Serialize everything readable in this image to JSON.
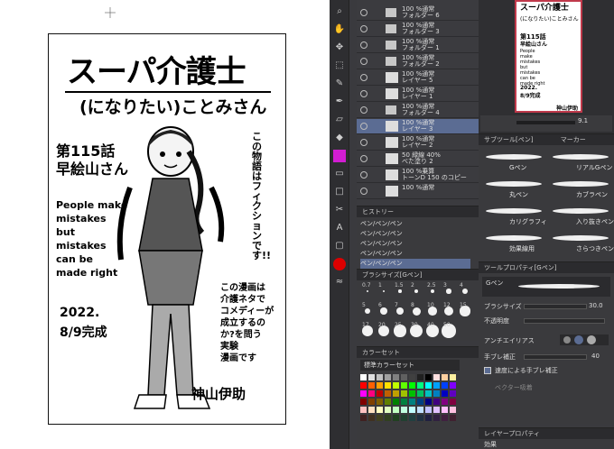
{
  "page": {
    "title_main": "スーパ介護士",
    "title_sub": "(になりたい)ことみさん",
    "episode_lines": [
      "第115話",
      "早絵山さん"
    ],
    "english_lines": [
      "People make",
      "mistakes",
      "but",
      "mistakes",
      "can be",
      "made right"
    ],
    "vertical_note": "この物語はフィクションです!!",
    "note_lines": [
      "この漫画は",
      "介護ネタで",
      "コメディーが",
      "成立するの",
      "か?を問う",
      "実験",
      "漫画です"
    ],
    "date_lines": [
      "2022.",
      "8/9完成"
    ],
    "author": "神山伊助"
  },
  "layers": {
    "rows": [
      {
        "label": "100 %通常\nフォルダー 6",
        "type": "folder"
      },
      {
        "label": "100 %通常\nフォルダー 3",
        "type": "folder"
      },
      {
        "label": "100 %通常\nフォルダー 1",
        "type": "folder"
      },
      {
        "label": "100 %通常\nフォルダー 2",
        "type": "folder"
      },
      {
        "label": "100 %通常\nレイヤー 5",
        "type": "layer"
      },
      {
        "label": "100 %通常\nレイヤー 1",
        "type": "layer"
      },
      {
        "label": "100 %通常\nフォルダー 4",
        "type": "folder"
      },
      {
        "label": "100 %通常\nレイヤー 3",
        "type": "layer",
        "selected": true
      },
      {
        "label": "100 %通常\nレイヤー 2",
        "type": "layer"
      },
      {
        "label": "50 緑線 40%\nべた塗り 2",
        "type": "layer"
      },
      {
        "label": "100 %乗算\nトーンD 150 のコピー",
        "type": "layer"
      },
      {
        "label": "100 %通常",
        "type": "layer"
      }
    ]
  },
  "navigator": {
    "title_lines": [
      "スーパ介護士",
      "(になりたい)ことみさん"
    ],
    "episode": "第115話",
    "episode2": "早絵山さん",
    "english": "People make mistakes but mistakes can be made right",
    "date": "2022. 8/9完成",
    "author": "神山伊助",
    "zoom": "9.1"
  },
  "history": {
    "title": "ヒストリー",
    "rows": [
      "ペン/ペン/ペン",
      "ペン/ペン/ペン",
      "ペン/ペン/ペン",
      "ペン/ペン/ペン",
      "ペン/ペン/ペン"
    ]
  },
  "subtools": {
    "tab1": "サブツール[ペン]",
    "tab2": "マーカー",
    "items": [
      {
        "name": "Gペン"
      },
      {
        "name": "リアルGペン"
      },
      {
        "name": "丸ペン"
      },
      {
        "name": "カブラペン"
      },
      {
        "name": "カリグラフィ"
      },
      {
        "name": "入り抜きペン"
      },
      {
        "name": "効果線用"
      },
      {
        "name": "さらつきペン"
      }
    ]
  },
  "brushsize": {
    "title": "ブラシサイズ[Gペン]",
    "labels": [
      "0.7",
      "1",
      "1.5",
      "2",
      "2.5",
      "3",
      "4",
      "5",
      "6",
      "7",
      "8",
      "10",
      "12",
      "15",
      "17",
      "20",
      "25",
      "30",
      "40",
      "50"
    ]
  },
  "colorset": {
    "title": "カラーセット",
    "name": "標準カラーセット"
  },
  "toolprop": {
    "title": "ツールプロパティ[Gペン]",
    "tool_name": "Gペン",
    "brush_size_label": "ブラシサイズ",
    "brush_size_value": "30.0",
    "opacity_label": "不透明度",
    "antialias_label": "アンチエイリアス",
    "stabilize_label": "手ブレ補正",
    "stabilize_value": "40",
    "speed_label": "速度による手ブレ補正",
    "vector_label": "ベクター吸着"
  },
  "layerprop": {
    "title": "レイヤープロパティ",
    "effect_label": "効果"
  },
  "colors": {
    "ui_bg": "#3a3a3e",
    "accent_selected": "#5b6c93",
    "nav_border": "#c0394b"
  }
}
